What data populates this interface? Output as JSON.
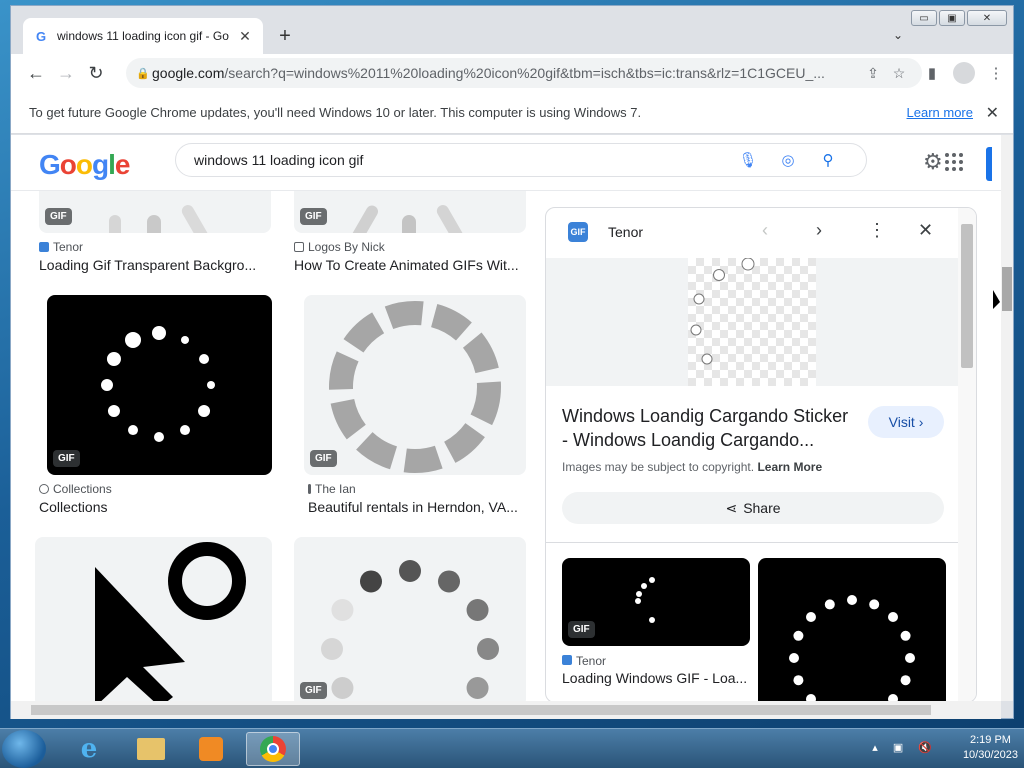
{
  "tab": {
    "title": "windows 11 loading icon gif - Go",
    "favicon": "G",
    "close": "✕"
  },
  "new_tab": "+",
  "tab_search": "⌄",
  "window_buttons": {
    "minimize": "▭",
    "maximize": "▣",
    "close": "✕"
  },
  "toolbar": {
    "back": "←",
    "forward": "→",
    "reload": "↻",
    "url_host": "google.com",
    "url_rest": "/search?q=windows%2011%20loading%20icon%20gif&tbm=isch&tbs=ic:trans&rlz=1C1GCEU_...",
    "share_icon": "⇪",
    "star_icon": "☆",
    "sidepanel_icon": "▮",
    "menu_icon": "⋮"
  },
  "infobar": {
    "message": "To get future Google Chrome updates, you'll need Windows 10 or later. This computer is using Windows 7.",
    "learn_more": "Learn more",
    "close": "✕"
  },
  "google": {
    "logo": [
      "G",
      "o",
      "o",
      "g",
      "l",
      "e"
    ],
    "logo_colors": [
      "#4285f4",
      "#ea4335",
      "#fbbc05",
      "#4285f4",
      "#34a853",
      "#ea4335"
    ],
    "query": "windows 11 loading icon gif",
    "mic_icon": "🎙",
    "lens_icon": "◎",
    "search_icon": "⚲",
    "settings_icon": "⚙"
  },
  "results": [
    {
      "source": "Tenor",
      "title": "Loading Gif Transparent Backgro...",
      "source_color": "#3b82d8"
    },
    {
      "source": "Logos By Nick",
      "title": "How To Create Animated GIFs Wit...",
      "source_color": "#5f6368"
    },
    {
      "source": "Collections",
      "title": "Collections",
      "source_color": "#5f6368",
      "badge": "GIF"
    },
    {
      "source": "The Ian",
      "title": "Beautiful rentals in Herndon, VA...",
      "source_color": "#5f6368",
      "badge": "GIF"
    }
  ],
  "gif_badge": "GIF",
  "panel": {
    "source": "Tenor",
    "logo_text": "GIF",
    "prev": "‹",
    "next": "›",
    "more": "⋮",
    "close": "✕",
    "title": "Windows Loandig Cargando Sticker - Windows Loandig Cargando...",
    "visit": "Visit ›",
    "copyright": "Images may be subject to copyright.",
    "copyright_link": "Learn More",
    "share": "Share",
    "related_source": "Tenor",
    "related_title": "Loading Windows GIF - Loa...",
    "related_badge": "GIF"
  },
  "taskbar": {
    "time": "2:19 PM",
    "date": "10/30/2023"
  }
}
